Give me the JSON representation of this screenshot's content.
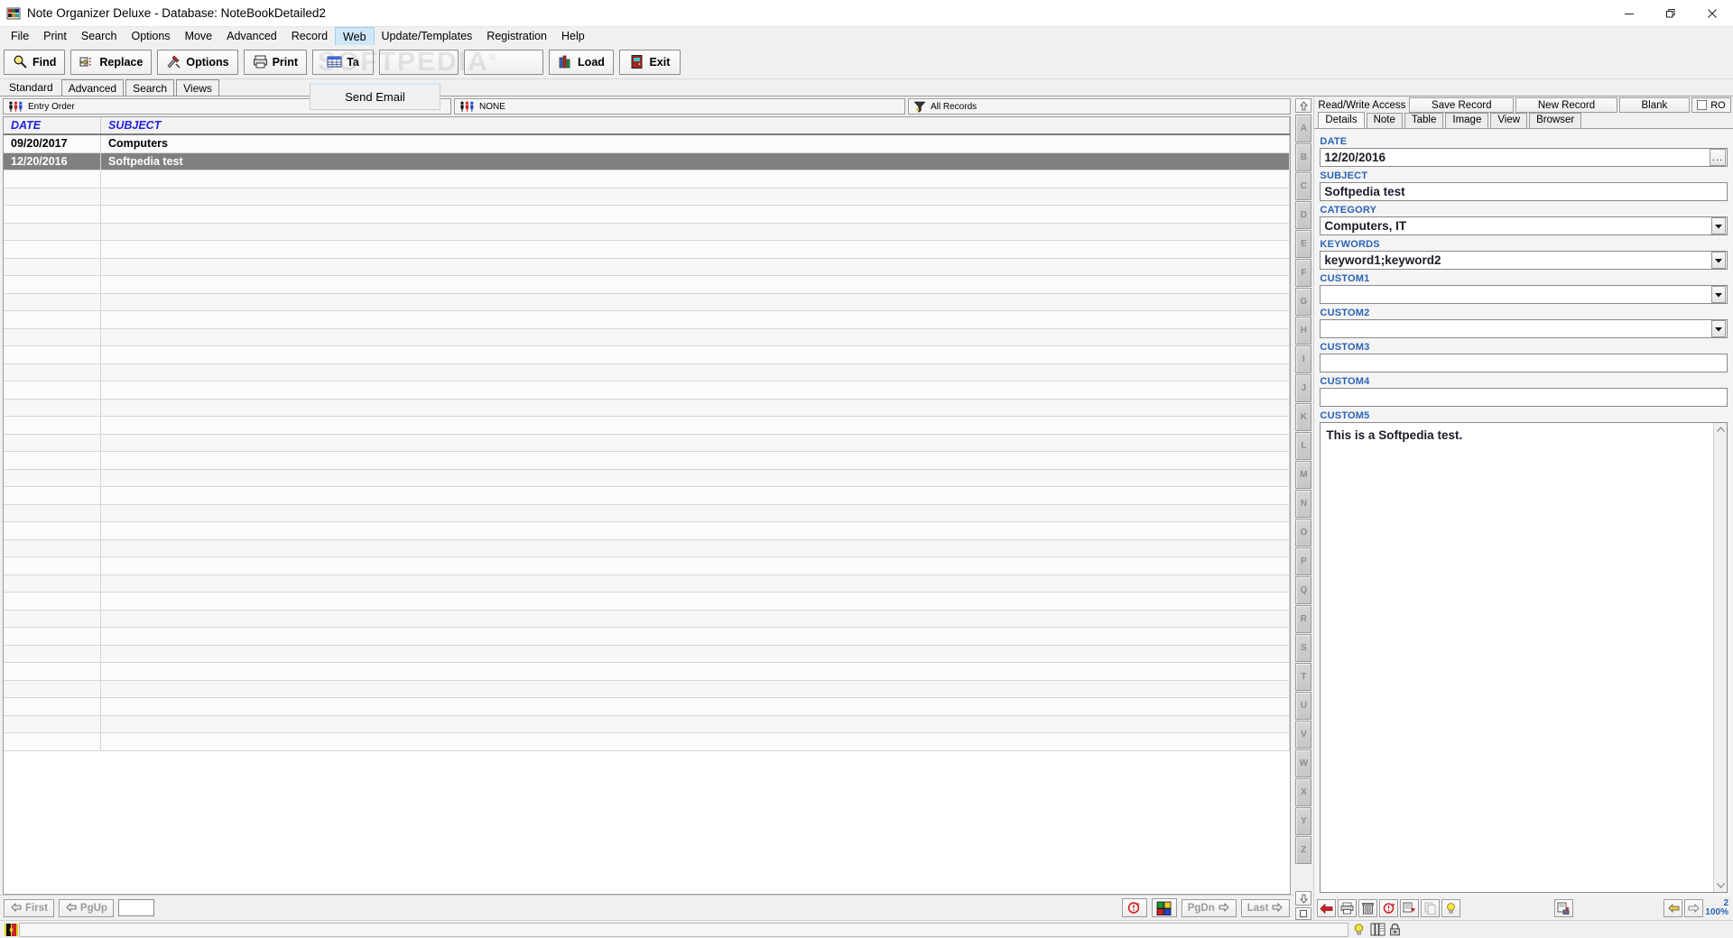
{
  "window": {
    "title": "Note Organizer Deluxe - Database: NoteBookDetailed2",
    "app_icon": "note-organizer-icon",
    "minimize_label": "—",
    "maximize_label": "❐",
    "close_label": "✕"
  },
  "menubar": {
    "items": [
      {
        "label": "File",
        "active": false
      },
      {
        "label": "Print",
        "active": false
      },
      {
        "label": "Search",
        "active": false
      },
      {
        "label": "Options",
        "active": false
      },
      {
        "label": "Move",
        "active": false
      },
      {
        "label": "Advanced",
        "active": false
      },
      {
        "label": "Record",
        "active": false
      },
      {
        "label": "Web",
        "active": true
      },
      {
        "label": "Update/Templates",
        "active": false
      },
      {
        "label": "Registration",
        "active": false
      },
      {
        "label": "Help",
        "active": false
      }
    ]
  },
  "toolbar": {
    "buttons": [
      {
        "label": "Find",
        "icon": "magnifier-icon"
      },
      {
        "label": "Replace",
        "icon": "replace-hand-icon"
      },
      {
        "label": "Options",
        "icon": "tools-icon"
      },
      {
        "label": "Print",
        "icon": "printer-icon"
      },
      {
        "label": "Ta",
        "icon": "table-icon"
      },
      {
        "label": "",
        "icon": "blank-icon"
      },
      {
        "label": "",
        "icon": "blank-icon"
      },
      {
        "label": "Load",
        "icon": "books-icon"
      },
      {
        "label": "Exit",
        "icon": "door-icon"
      }
    ],
    "watermark": "SOFTPEDIA",
    "watermark_mark": "®",
    "dropdown": {
      "label": "Send Email"
    }
  },
  "view_tabs": {
    "items": [
      {
        "label": "Standard",
        "selected": true
      },
      {
        "label": "Advanced",
        "selected": false
      },
      {
        "label": "Search",
        "selected": false
      },
      {
        "label": "Views",
        "selected": false
      }
    ]
  },
  "sortbar": {
    "sort_order": {
      "label": "Entry Order",
      "icon": "people-sort-icon"
    },
    "group": {
      "label": "NONE",
      "icon": "people-sort-icon"
    },
    "filter": {
      "label": "All Records",
      "icon": "funnel-icon"
    }
  },
  "grid": {
    "columns": [
      "DATE",
      "SUBJECT"
    ],
    "rows": [
      {
        "date": "09/20/2017",
        "subject": "Computers",
        "selected": false
      },
      {
        "date": "12/20/2016",
        "subject": "Softpedia test",
        "selected": true
      }
    ],
    "empty_row_count": 33
  },
  "left_nav": {
    "first_label": "First",
    "pgup_label": "PgUp",
    "goto_value": "",
    "pgdn_label": "PgDn",
    "last_label": "Last",
    "refresh_icon": "refresh-clock-icon",
    "blocks_icon": "color-blocks-icon"
  },
  "alphabet_strip": {
    "up_icon": "up-arrow-icon",
    "down_icon": "down-arrow-icon",
    "letters": [
      "A",
      "B",
      "C",
      "D",
      "E",
      "F",
      "G",
      "H",
      "I",
      "J",
      "K",
      "L",
      "M",
      "N",
      "O",
      "P",
      "Q",
      "R",
      "S",
      "T",
      "U",
      "V",
      "W",
      "X",
      "Y",
      "Z"
    ],
    "square_icon": "stop-square-icon"
  },
  "record_bar": {
    "access_label": "Read/Write Access",
    "save_label": "Save Record",
    "new_label": "New Record",
    "blank_label": "Blank",
    "ro_label": "RO",
    "ro_checked": false
  },
  "detail_tabs": {
    "items": [
      {
        "label": "Details",
        "selected": true
      },
      {
        "label": "Note",
        "selected": false
      },
      {
        "label": "Table",
        "selected": false
      },
      {
        "label": "Image",
        "selected": false
      },
      {
        "label": "View",
        "selected": false
      },
      {
        "label": "Browser",
        "selected": false
      }
    ]
  },
  "form": {
    "fields": [
      {
        "label": "DATE",
        "value": "12/20/2016",
        "control": "text-with-picker",
        "picker_label": "..."
      },
      {
        "label": "SUBJECT",
        "value": "Softpedia test",
        "control": "text"
      },
      {
        "label": "CATEGORY",
        "value": "Computers, IT",
        "control": "combo"
      },
      {
        "label": "KEYWORDS",
        "value": "keyword1;keyword2",
        "control": "combo"
      },
      {
        "label": "CUSTOM1",
        "value": "",
        "control": "combo"
      },
      {
        "label": "CUSTOM2",
        "value": "",
        "control": "combo"
      },
      {
        "label": "CUSTOM3",
        "value": "",
        "control": "text"
      },
      {
        "label": "CUSTOM4",
        "value": "",
        "control": "text"
      },
      {
        "label": "CUSTOM5",
        "value": "This is a Softpedia test.",
        "control": "textarea"
      }
    ]
  },
  "right_bottom": {
    "buttons": [
      {
        "icon": "back-arrow-icon"
      },
      {
        "icon": "printer-icon"
      },
      {
        "icon": "trash-icon"
      },
      {
        "icon": "refresh-clock-icon"
      },
      {
        "icon": "document-arrow-icon"
      },
      {
        "icon": "copy-disabled-icon"
      },
      {
        "icon": "lightbulb-icon"
      },
      {
        "icon": "save-document-icon"
      },
      {
        "icon": "prev-hand-icon"
      },
      {
        "icon": "next-hand-icon"
      }
    ],
    "record_count": "2",
    "zoom_level": "100%"
  },
  "statusbar": {
    "left_icon": "red-black-book-icon",
    "right_icons": [
      "lightbulb-icon",
      "books-icon",
      "lock-icon"
    ]
  }
}
